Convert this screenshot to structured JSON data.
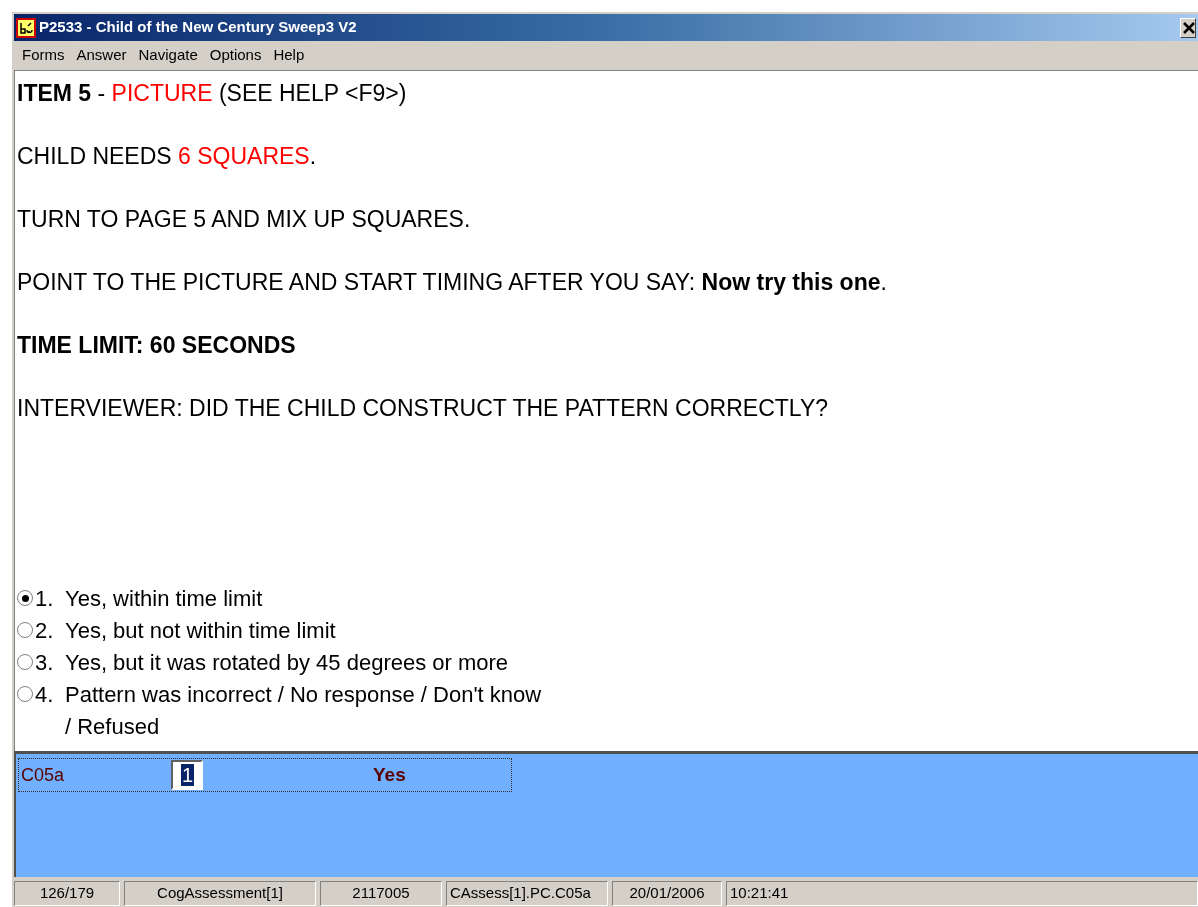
{
  "window": {
    "title": "P2533 - Child of the New Century Sweep3 V2"
  },
  "menu": [
    "Forms",
    "Answer",
    "Navigate",
    "Options",
    "Help"
  ],
  "question": [
    [
      {
        "kind": "bold",
        "text": "ITEM 5"
      },
      {
        "kind": "plain",
        "text": " - "
      },
      {
        "kind": "red",
        "text": "PICTURE"
      },
      {
        "kind": "plain",
        "text": " (SEE HELP <F9>)"
      }
    ],
    [
      {
        "kind": "plain",
        "text": "CHILD NEEDS "
      },
      {
        "kind": "red",
        "text": "6 SQUARES"
      },
      {
        "kind": "plain",
        "text": "."
      }
    ],
    [
      {
        "kind": "plain",
        "text": "TURN TO PAGE 5 AND MIX UP SQUARES."
      }
    ],
    [
      {
        "kind": "plain",
        "text": "POINT TO THE PICTURE AND START TIMING AFTER YOU SAY: "
      },
      {
        "kind": "bold",
        "text": "Now try this one"
      },
      {
        "kind": "plain",
        "text": "."
      }
    ],
    [
      {
        "kind": "bold",
        "text": "TIME LIMIT: 60 SECONDS"
      }
    ],
    [
      {
        "kind": "plain",
        "text": "INTERVIEWER: DID THE CHILD CONSTRUCT THE PATTERN CORRECTLY?"
      }
    ]
  ],
  "options": [
    {
      "number": "1.",
      "label": "Yes, within time limit",
      "selected": true
    },
    {
      "number": "2.",
      "label": "Yes, but not within time limit",
      "selected": false
    },
    {
      "number": "3.",
      "label": "Yes, but it was rotated by 45 degrees or more",
      "selected": false
    },
    {
      "number": "4.",
      "label": "Pattern was incorrect / No response / Don't know / Refused",
      "selected": false
    }
  ],
  "answer": {
    "field_name": "C05a",
    "value": "1",
    "answer_text": "Yes"
  },
  "status_bar": [
    "126/179",
    "CogAssessment[1]",
    "2117005",
    "CAssess[1].PC.C05a",
    "20/01/2006",
    "10:21:41"
  ]
}
